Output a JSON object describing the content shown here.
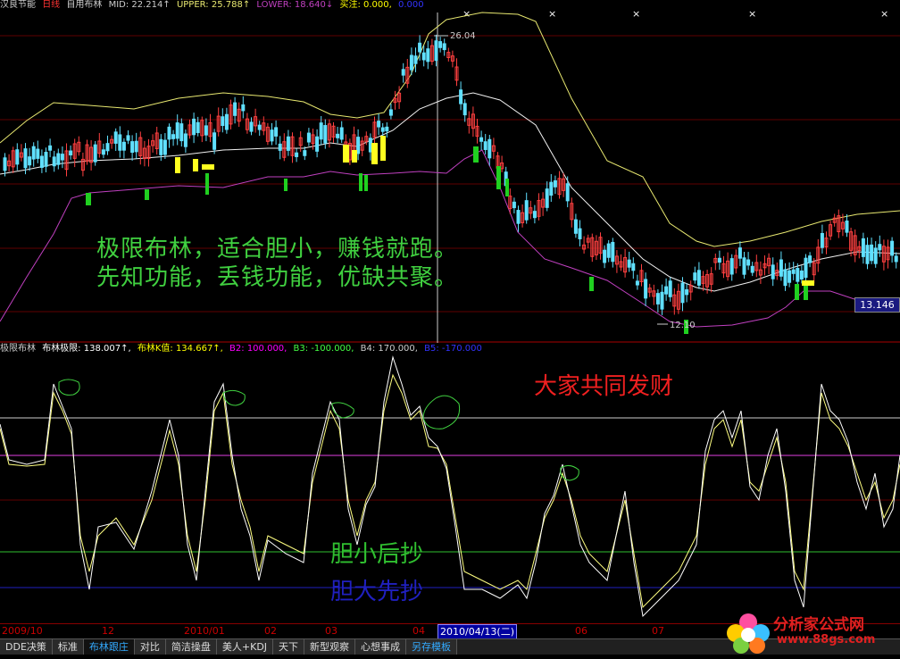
{
  "top_header": {
    "name": "汉良节能",
    "period": "日线",
    "indicator": "自用布林",
    "mid": "MID: 22.214↑",
    "upper": "UPPER: 25.788↑",
    "lower": "LOWER: 18.640↓",
    "kz": "买注: 0.000,",
    "extra": "0.000"
  },
  "main_chart": {
    "high_label": "26.04",
    "low_label": "12.10",
    "current_price": "13.146",
    "annotation_line1": "极限布林，适合胆小，赚钱就跑。",
    "annotation_line2": "先知功能，丢钱功能，优缺共聚。",
    "colors": {
      "upper": "#e8e870",
      "mid": "#f0f0f0",
      "lower": "#c040c0",
      "up_candle": "#ff4040",
      "down_candle": "#60e0ff",
      "green_signal": "#20d020",
      "yellow_signal": "#ffff20"
    }
  },
  "sub_header": {
    "name": "极限布林",
    "limit": "布林极限: 138.007↑,",
    "kval": "布林K值: 134.667↑,",
    "b2": "B2: 100.000,",
    "b3": "B3: -100.000,",
    "b4": "B4: 170.000,",
    "b5": "B5: -170.000"
  },
  "sub_chart": {
    "title": "大家共同发财",
    "label_small": "胆小后抄",
    "label_big": "胆大先抄"
  },
  "date_axis": {
    "labels": [
      "2009/10",
      "12",
      "2010/01",
      "02",
      "03",
      "04",
      "06",
      "07"
    ],
    "cursor": "2010/04/13(二)"
  },
  "tabs": [
    "DDE决策",
    "标准",
    "布林跟庄",
    "对比",
    "简洁操盘",
    "美人+KDJ",
    "天下",
    "新型观察",
    "心想事成",
    "另存模板"
  ],
  "active_tab": "布林跟庄",
  "logo": {
    "name": "分析家公式网",
    "url": "www.88gs.com"
  }
}
